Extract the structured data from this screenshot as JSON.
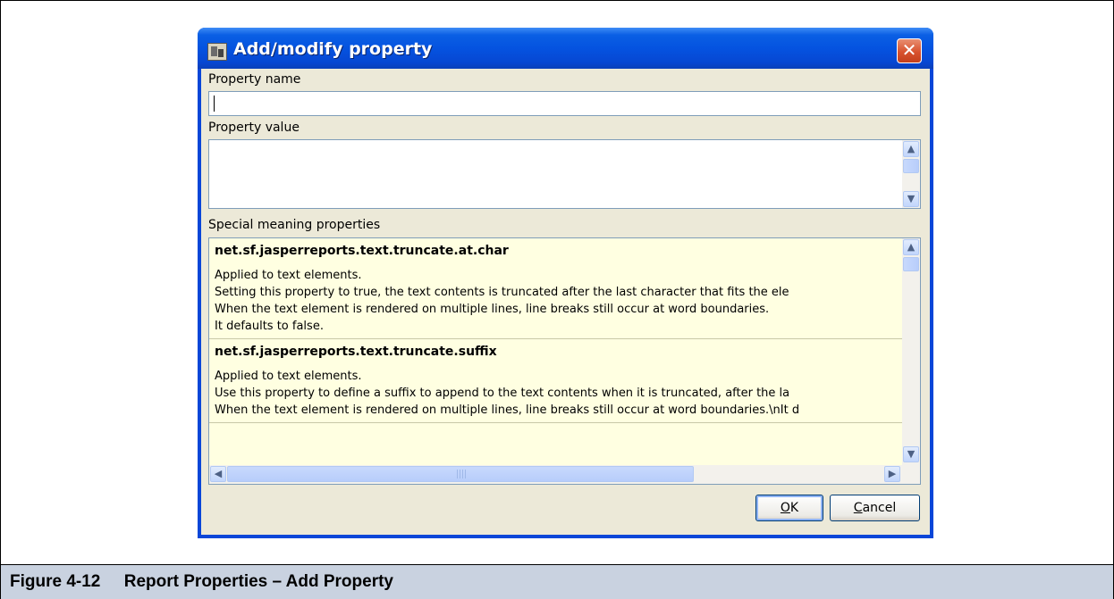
{
  "figure": {
    "caption": "Figure 4-12     Report Properties – Add Property"
  },
  "dialog": {
    "title": "Add/modify property",
    "close_label": "✕",
    "property_name_label": "Property name",
    "property_name_value": "",
    "property_value_label": "Property value",
    "property_value_text": "",
    "special_label": "Special meaning properties",
    "special_properties": [
      {
        "name": "net.sf.jasperreports.text.truncate.at.char",
        "lines": [
          "Applied to text elements.",
          "Setting this property to true, the text contents is truncated after the last character that fits the ele",
          "When the text element is rendered on multiple lines, line breaks still occur at word boundaries.",
          "It defaults to false."
        ]
      },
      {
        "name": "net.sf.jasperreports.text.truncate.suffix",
        "lines": [
          "Applied to text elements.",
          "Use this property to define a suffix to append to the text contents when it is truncated, after the la",
          "When the text element is rendered on multiple lines, line breaks still occur at word boundaries.\\nIt d"
        ]
      }
    ],
    "ok_label": "OK",
    "ok_mnemonic": "O",
    "ok_rest": "K",
    "cancel_mnemonic": "C",
    "cancel_rest": "ancel"
  },
  "icons": {
    "up": "▲",
    "down": "▼",
    "left": "◀",
    "right": "▶"
  },
  "colors": {
    "titlebar": "#0553e0",
    "client": "#ece9d8",
    "list_background": "#ffffe1",
    "caption_bar": "#c9d2e0"
  }
}
